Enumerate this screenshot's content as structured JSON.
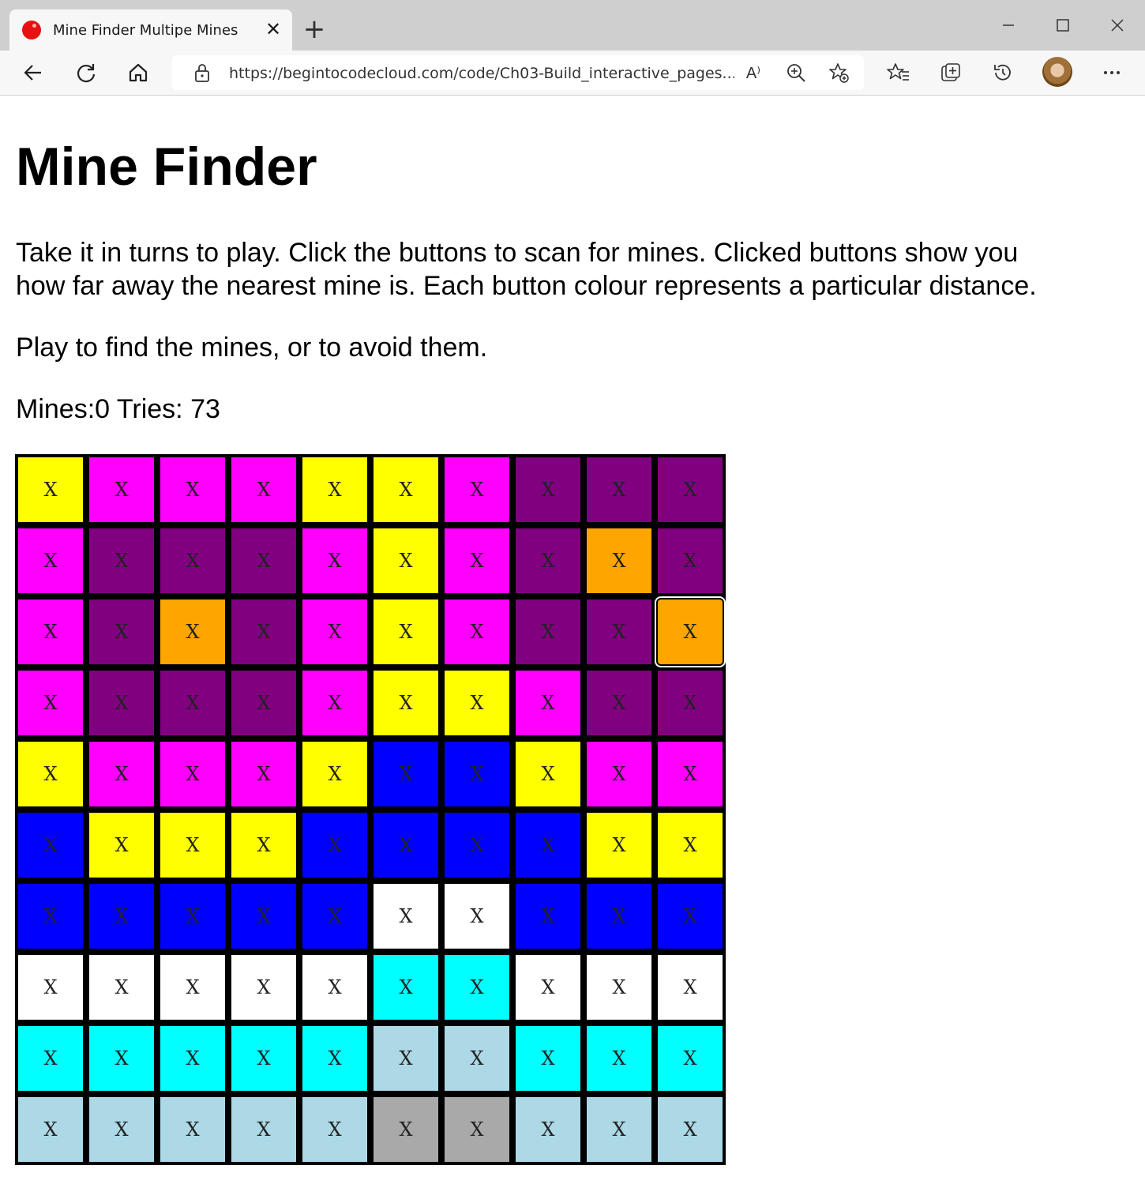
{
  "browser": {
    "tab_title": "Mine Finder Multipe Mines",
    "tab_close": "✕",
    "new_tab": "+",
    "url": "https://begintocodecloud.com/code/Ch03-Build_interactive_pages...",
    "read_aloud": "A⁾",
    "icons": [
      "back-icon",
      "refresh-icon",
      "home-icon",
      "lock-icon",
      "read-aloud-icon",
      "zoom-icon",
      "add-favorite-icon",
      "favorites-icon",
      "collections-icon",
      "history-icon",
      "profile-avatar",
      "more-icon"
    ]
  },
  "page": {
    "title": "Mine Finder",
    "paragraph1_line1": "Take it in turns to play. Click the buttons to scan for mines. Clicked buttons show you",
    "paragraph1_line2": "how far away the nearest mine is. Each button colour represents a particular distance.",
    "paragraph2": "Play to find the mines, or to avoid them.",
    "status": "Mines:0 Tries: 73"
  },
  "board": {
    "button_label": "X",
    "colors": {
      "Y": "#ffff00",
      "M": "#ff00ff",
      "P": "#800080",
      "O": "#ffa500",
      "B": "#0000ff",
      "W": "#ffffff",
      "C": "#00ffff",
      "L": "#add8e6",
      "G": "#a9a9a9"
    },
    "rows": [
      [
        "Y",
        "M",
        "M",
        "M",
        "Y",
        "Y",
        "M",
        "P",
        "P",
        "P"
      ],
      [
        "M",
        "P",
        "P",
        "P",
        "M",
        "Y",
        "M",
        "P",
        "O",
        "P"
      ],
      [
        "M",
        "P",
        "O",
        "P",
        "M",
        "Y",
        "M",
        "P",
        "P",
        "O"
      ],
      [
        "M",
        "P",
        "P",
        "P",
        "M",
        "Y",
        "Y",
        "M",
        "P",
        "P"
      ],
      [
        "Y",
        "M",
        "M",
        "M",
        "Y",
        "B",
        "B",
        "Y",
        "M",
        "M"
      ],
      [
        "B",
        "Y",
        "Y",
        "Y",
        "B",
        "B",
        "B",
        "B",
        "Y",
        "Y"
      ],
      [
        "B",
        "B",
        "B",
        "B",
        "B",
        "W",
        "W",
        "B",
        "B",
        "B"
      ],
      [
        "W",
        "W",
        "W",
        "W",
        "W",
        "C",
        "C",
        "W",
        "W",
        "W"
      ],
      [
        "C",
        "C",
        "C",
        "C",
        "C",
        "L",
        "L",
        "C",
        "C",
        "C"
      ],
      [
        "L",
        "L",
        "L",
        "L",
        "L",
        "G",
        "G",
        "L",
        "L",
        "L"
      ]
    ],
    "focused_cell": [
      2,
      9
    ]
  }
}
